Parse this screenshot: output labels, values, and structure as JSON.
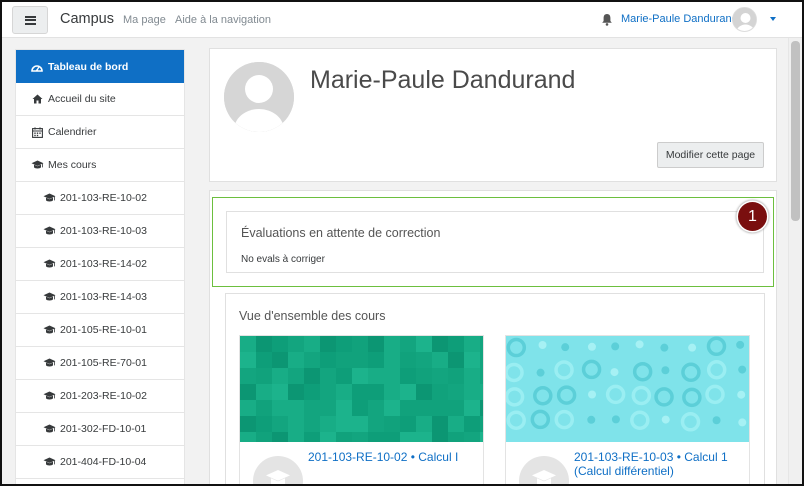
{
  "navbar": {
    "site_name": "Campus",
    "links": [
      "Ma page",
      "Aide à la navigation"
    ],
    "user_name": "Marie-Paule Dandurand"
  },
  "sidebar": {
    "items": [
      {
        "label": "Tableau de bord",
        "icon": "dashboard-icon",
        "active": true
      },
      {
        "label": "Accueil du site",
        "icon": "home-icon"
      },
      {
        "label": "Calendrier",
        "icon": "calendar-icon"
      },
      {
        "label": "Mes cours",
        "icon": "graduation-cap-icon"
      },
      {
        "label": "201-103-RE-10-02",
        "icon": "graduation-cap-icon"
      },
      {
        "label": "201-103-RE-10-03",
        "icon": "graduation-cap-icon"
      },
      {
        "label": "201-103-RE-14-02",
        "icon": "graduation-cap-icon"
      },
      {
        "label": "201-103-RE-14-03",
        "icon": "graduation-cap-icon"
      },
      {
        "label": "201-105-RE-10-01",
        "icon": "graduation-cap-icon"
      },
      {
        "label": "201-105-RE-70-01",
        "icon": "graduation-cap-icon"
      },
      {
        "label": "201-203-RE-10-02",
        "icon": "graduation-cap-icon"
      },
      {
        "label": "201-302-FD-10-01",
        "icon": "graduation-cap-icon"
      },
      {
        "label": "201-404-FD-10-04",
        "icon": "graduation-cap-icon"
      }
    ]
  },
  "header": {
    "user_name": "Marie-Paule Dandurand",
    "edit_button": "Modifier cette page"
  },
  "evals_block": {
    "title": "Évaluations en attente de correction",
    "text": "No evals à corriger",
    "callout_number": "1"
  },
  "courses_block": {
    "title": "Vue d'ensemble des cours",
    "courses": [
      {
        "link": "201-103-RE-10-02 • Calcul I"
      },
      {
        "link": "201-103-RE-10-03 • Calcul 1 (Calcul différentiel)"
      }
    ]
  },
  "colors": {
    "brand_blue": "#0f6fc5",
    "highlight_green": "#6cbf3e",
    "callout_red": "#7a0f0f",
    "course_1_tile": "#13a57f",
    "course_2_tile": "#7fe3ea"
  }
}
